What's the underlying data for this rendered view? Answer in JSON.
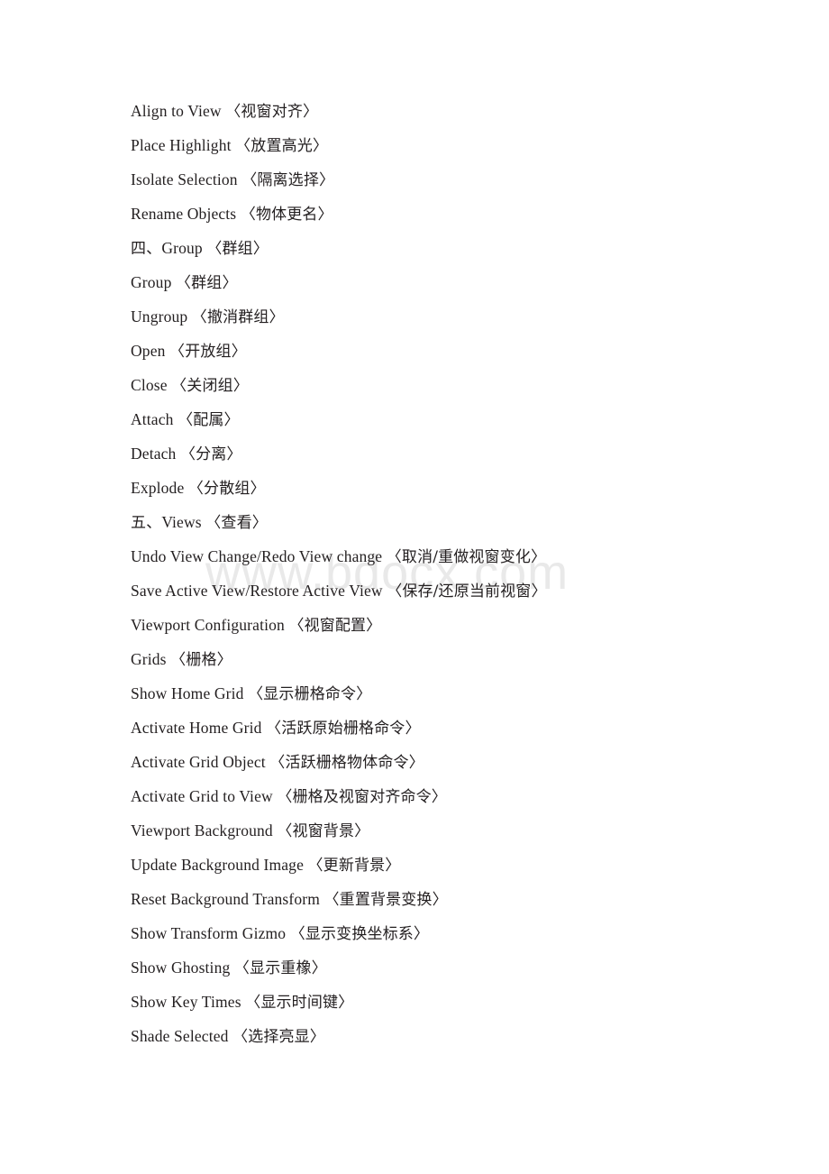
{
  "document": {
    "watermark": "www.bdocx.com",
    "text_color": "#231f20",
    "watermark_color": "#e9e9e9",
    "background_color": "#ffffff",
    "lines": [
      {
        "type": "entry",
        "en": "Align to View",
        "zh": "〈视窗对齐〉"
      },
      {
        "type": "entry",
        "en": "Place Highlight",
        "zh": "〈放置高光〉"
      },
      {
        "type": "entry",
        "en": "Isolate Selection",
        "zh": "〈隔离选择〉"
      },
      {
        "type": "entry",
        "en": "Rename Objects",
        "zh": "〈物体更名〉"
      },
      {
        "type": "heading",
        "num": "四、",
        "en": "Group",
        "zh": "〈群组〉"
      },
      {
        "type": "entry",
        "en": "Group",
        "zh": "〈群组〉"
      },
      {
        "type": "entry",
        "en": "Ungroup",
        "zh": "〈撤消群组〉"
      },
      {
        "type": "entry",
        "en": "Open",
        "zh": "〈开放组〉"
      },
      {
        "type": "entry",
        "en": "Close",
        "zh": "〈关闭组〉"
      },
      {
        "type": "entry",
        "en": "Attach",
        "zh": "〈配属〉"
      },
      {
        "type": "entry",
        "en": "Detach",
        "zh": "〈分离〉"
      },
      {
        "type": "entry",
        "en": "Explode",
        "zh": "〈分散组〉"
      },
      {
        "type": "heading",
        "num": "五、",
        "en": "Views",
        "zh": "〈查看〉"
      },
      {
        "type": "entry",
        "en": "Undo View Change/Redo View change",
        "zh": "〈取消/重做视窗变化〉"
      },
      {
        "type": "entry",
        "en": "Save Active View/Restore Active View",
        "zh": "〈保存/还原当前视窗〉"
      },
      {
        "type": "entry",
        "en": "Viewport Configuration",
        "zh": "〈视窗配置〉"
      },
      {
        "type": "entry",
        "en": "Grids",
        "zh": "〈栅格〉"
      },
      {
        "type": "entry",
        "en": "Show Home Grid",
        "zh": "〈显示栅格命令〉"
      },
      {
        "type": "entry",
        "en": "Activate Home Grid",
        "zh": "〈活跃原始栅格命令〉"
      },
      {
        "type": "entry",
        "en": "Activate Grid Object",
        "zh": "〈活跃栅格物体命令〉"
      },
      {
        "type": "entry",
        "en": "Activate Grid to View",
        "zh": "〈栅格及视窗对齐命令〉"
      },
      {
        "type": "entry",
        "en": "Viewport Background",
        "zh": "〈视窗背景〉"
      },
      {
        "type": "entry",
        "en": "Update Background Image",
        "zh": "〈更新背景〉"
      },
      {
        "type": "entry",
        "en": "Reset Background Transform",
        "zh": "〈重置背景变换〉"
      },
      {
        "type": "entry",
        "en": "Show Transform Gizmo",
        "zh": "〈显示变换坐标系〉"
      },
      {
        "type": "entry",
        "en": "Show Ghosting",
        "zh": "〈显示重橡〉"
      },
      {
        "type": "entry",
        "en": "Show Key Times",
        "zh": "〈显示时间键〉"
      },
      {
        "type": "entry",
        "en": "Shade Selected",
        "zh": "〈选择亮显〉"
      }
    ]
  }
}
